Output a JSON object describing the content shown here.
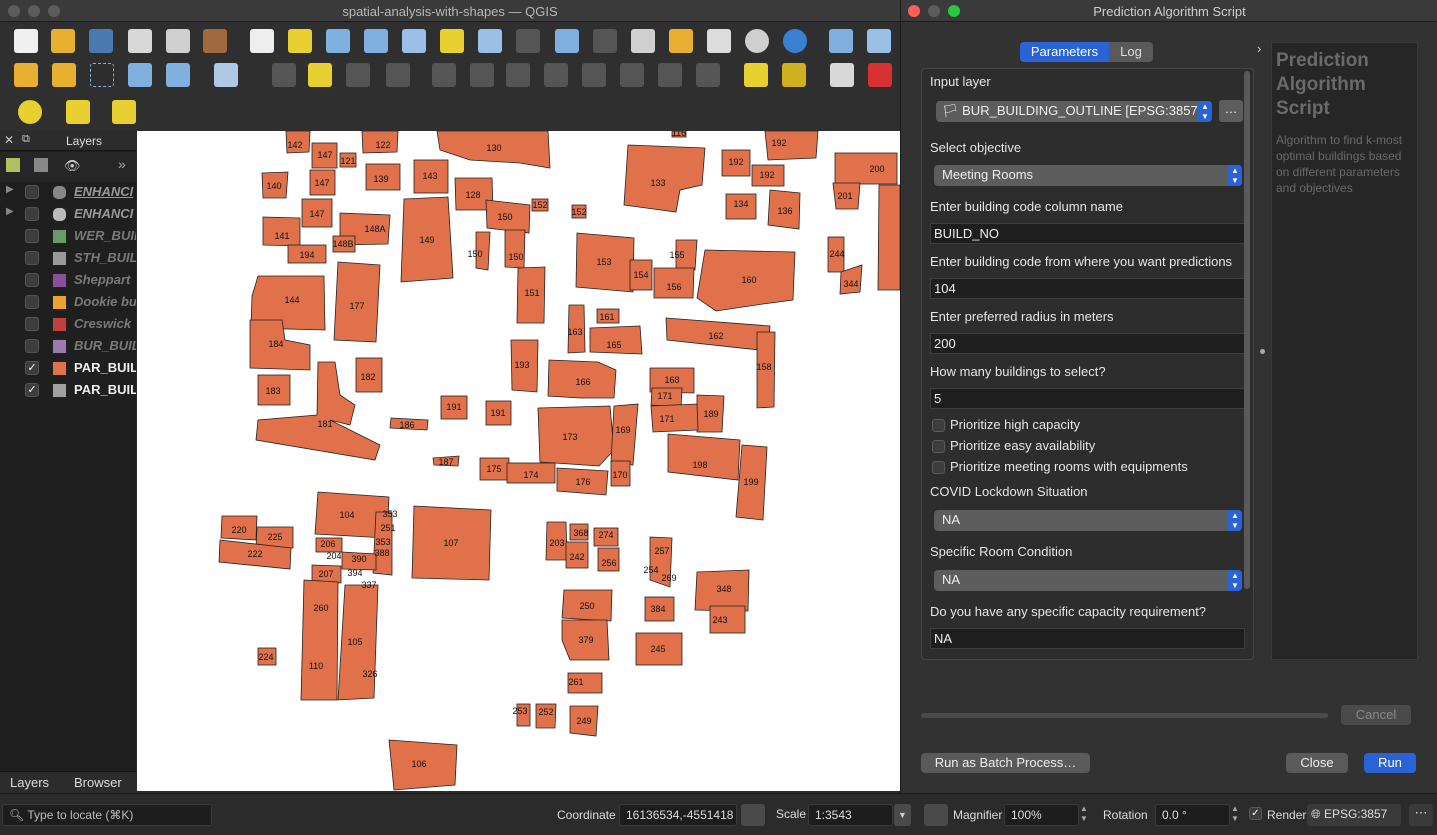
{
  "main_window": {
    "title": "spatial-analysis-with-shapes — QGIS"
  },
  "layers_panel": {
    "title": "Layers",
    "layers": [
      {
        "name": "ENHANCI",
        "checked": false,
        "color": "#888888"
      },
      {
        "name": "ENHANCI",
        "checked": false,
        "color": "#888888"
      },
      {
        "name": "WER_BUIL",
        "checked": false,
        "color": "#6a9a6a"
      },
      {
        "name": "STH_BUIL",
        "checked": false,
        "color": "#9a9a9a"
      },
      {
        "name": "Sheppart",
        "checked": false,
        "color": "#8a4f9a"
      },
      {
        "name": "Dookie bu",
        "checked": false,
        "color": "#f0a030"
      },
      {
        "name": "Creswick",
        "checked": false,
        "color": "#c04040"
      },
      {
        "name": "BUR_BUIL",
        "checked": false,
        "color": "#9a7ab0"
      },
      {
        "name": "PAR_BUIL",
        "checked": true,
        "color": "#e0714a"
      },
      {
        "name": "PAR_BUIL",
        "checked": true,
        "color": "#a0a0a0"
      }
    ],
    "tab_layers": "Layers",
    "tab_browser": "Browser"
  },
  "status_bar": {
    "locate_placeholder": "Type to locate (⌘K)",
    "coordinate_label": "Coordinate",
    "coordinate_value": "16136534,-4551418",
    "scale_label": "Scale",
    "scale_value": "1:3543",
    "magnifier_label": "Magnifier",
    "magnifier_value": "100%",
    "rotation_label": "Rotation",
    "rotation_value": "0.0 °",
    "render_label": "Render",
    "crs_value": "EPSG:3857"
  },
  "dialog": {
    "title": "Prediction Algorithm Script",
    "tab_parameters": "Parameters",
    "tab_log": "Log",
    "input_layer_label": "Input layer",
    "input_layer_value": "BUR_BUILDING_OUTLINE [EPSG:3857",
    "objective_label": "Select objective",
    "objective_value": "Meeting Rooms",
    "code_column_label": "Enter building code column name",
    "code_column_value": "BUILD_NO",
    "code_from_label": "Enter building code from where you want predictions",
    "code_from_value": "104",
    "radius_label": "Enter preferred radius in meters",
    "radius_value": "200",
    "count_label": "How many buildings to select?",
    "count_value": "5",
    "check_high_capacity": "Prioritize high capacity",
    "check_easy_availability": "Prioritize easy availability",
    "check_equipments": "Prioritize meeting rooms with equipments",
    "covid_label": "COVID Lockdown Situation",
    "covid_value": "NA",
    "room_condition_label": "Specific Room Condition",
    "room_condition_value": "NA",
    "capacity_label": "Do you have any specific capacity requirement?",
    "capacity_value": "NA",
    "help_title": "Prediction Algorithm Script",
    "help_text": "Algorithm to find k-most optimal buildings based on different parameters and objectives",
    "cancel_label": "Cancel",
    "batch_label": "Run as Batch Process…",
    "close_label": "Close",
    "run_label": "Run"
  },
  "map_labels": {
    "b142": "142",
    "b147a": "147",
    "b121": "121",
    "b122": "122",
    "b130": "130",
    "b116": "116",
    "b192a": "192",
    "b192b": "192",
    "b140": "140",
    "b147b": "147",
    "b139": "139",
    "b143": "143",
    "b133": "133",
    "b200": "200",
    "b128": "128",
    "b152a": "152",
    "b152b": "152",
    "b134": "134",
    "b136": "136",
    "b201": "201",
    "b147c": "147",
    "b150a": "150",
    "b148a": "148A",
    "b141": "141",
    "b148b": "148B",
    "b149": "149",
    "b150b": "150",
    "b150c": "150",
    "b194": "194",
    "b155": "155",
    "b153": "153",
    "b154": "154",
    "b156": "156",
    "b160": "160",
    "b244": "244",
    "b344": "344",
    "b144": "144",
    "b177": "177",
    "b151": "151",
    "b161": "161",
    "b163": "163",
    "b165": "165",
    "b162": "162",
    "b184": "184",
    "b193": "193",
    "b158": "158",
    "b182": "182",
    "b166": "166",
    "b168": "168",
    "b171a": "171",
    "b183": "183",
    "b191a": "191",
    "b191b": "191",
    "b189": "189",
    "b171b": "171",
    "b181": "181",
    "b186": "186",
    "b173": "173",
    "b169": "169",
    "b187": "187",
    "b175": "175",
    "b174": "174",
    "b176": "176",
    "b170": "170",
    "b198": "198",
    "b199": "199",
    "b104": "104",
    "b353a": "353",
    "b251": "251",
    "b353b": "353",
    "b388": "388",
    "b107": "107",
    "b220": "220",
    "b225": "225",
    "b222": "222",
    "b206": "206",
    "b204": "204",
    "b390": "390",
    "b394": "394",
    "b337": "337",
    "b207": "207",
    "b203": "203",
    "b368": "368",
    "b274": "274",
    "b242": "242",
    "b256": "256",
    "b257": "257",
    "b254": "254",
    "b269": "269",
    "b348": "348",
    "b260": "260",
    "b250": "250",
    "b384": "384",
    "b243": "243",
    "b105": "105",
    "b379": "379",
    "b245": "245",
    "b224": "224",
    "b110": "110",
    "b326": "326",
    "b261": "261",
    "b253": "253",
    "b252": "252",
    "b249": "249",
    "b106": "106"
  }
}
